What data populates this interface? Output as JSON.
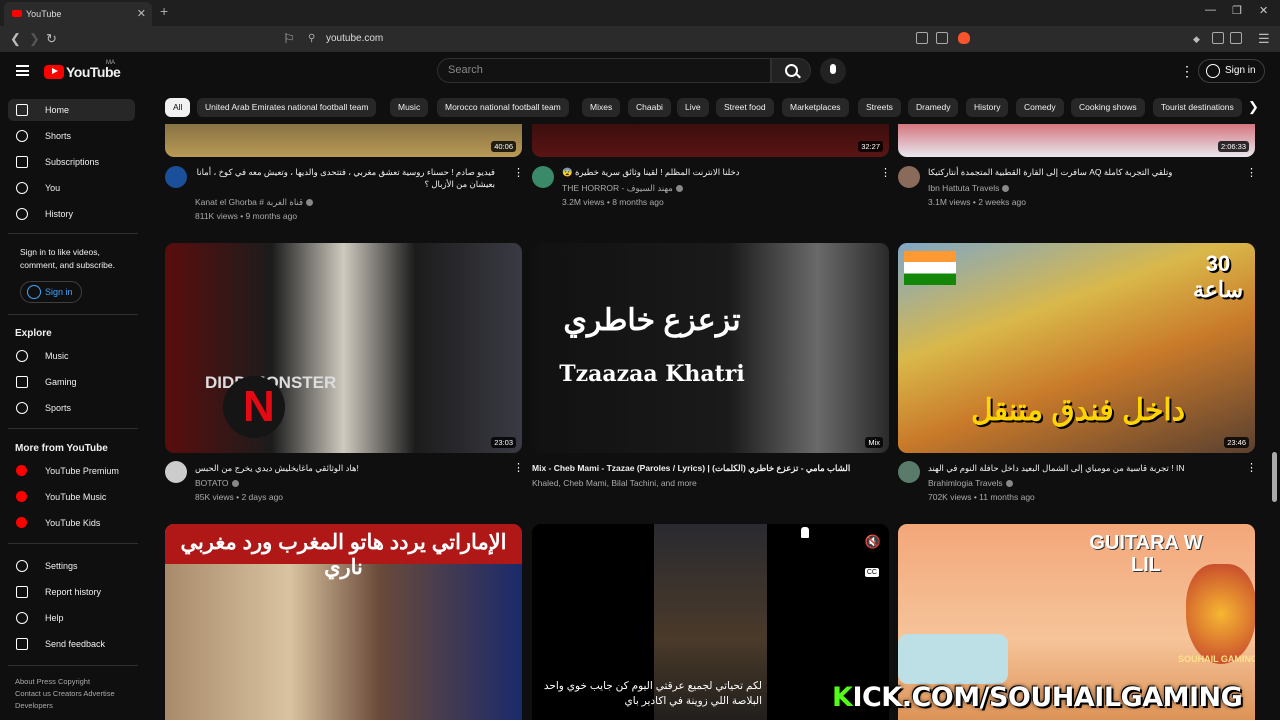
{
  "browser": {
    "tab_title": "YouTube",
    "url": "youtube.com"
  },
  "header": {
    "logo_text": "YouTube",
    "country_code": "MA",
    "search_placeholder": "Search",
    "signin_label": "Sign in"
  },
  "sidebar": {
    "nav": [
      {
        "label": "Home",
        "icon": "home-icon"
      },
      {
        "label": "Shorts",
        "icon": "shorts-icon"
      },
      {
        "label": "Subscriptions",
        "icon": "subscriptions-icon"
      },
      {
        "label": "You",
        "icon": "you-icon"
      },
      {
        "label": "History",
        "icon": "history-icon"
      }
    ],
    "signin_note": "Sign in to like videos, comment, and subscribe.",
    "signin_label": "Sign in",
    "explore_heading": "Explore",
    "explore": [
      {
        "label": "Music",
        "icon": "music-icon"
      },
      {
        "label": "Gaming",
        "icon": "gaming-icon"
      },
      {
        "label": "Sports",
        "icon": "sports-icon"
      }
    ],
    "more_heading": "More from YouTube",
    "more": [
      {
        "label": "YouTube Premium",
        "icon": "youtube-premium-icon"
      },
      {
        "label": "YouTube Music",
        "icon": "youtube-music-icon"
      },
      {
        "label": "YouTube Kids",
        "icon": "youtube-kids-icon"
      }
    ],
    "settings": [
      {
        "label": "Settings",
        "icon": "gear-icon"
      },
      {
        "label": "Report history",
        "icon": "flag-icon"
      },
      {
        "label": "Help",
        "icon": "help-icon"
      },
      {
        "label": "Send feedback",
        "icon": "feedback-icon"
      }
    ],
    "footer_line1": "About  Press  Copyright",
    "footer_line2": "Contact us  Creators  Advertise",
    "footer_line3": "Developers"
  },
  "chips": [
    "All",
    "United Arab Emirates national football team",
    "Music",
    "Morocco national football team",
    "Mixes",
    "Chaabi",
    "Live",
    "Street food",
    "Marketplaces",
    "Streets",
    "Dramedy",
    "History",
    "Comedy",
    "Cooking shows",
    "Tourist destinations"
  ],
  "videos": [
    {
      "title": "فيديو صادم ! حسناء روسية تعشق مغربي ، فتتحدى والديها ، وتعيش معه في كوخ ، أمانا بعيشان من الأزبال ؟",
      "channel": "Kanat el Ghorba # قناة الغربة",
      "meta": "811K views • 9 months ago",
      "duration": "40:06"
    },
    {
      "title": "😨 دخلنا الانترنت المظلم ! لقينا وثائق سرية خطيرة",
      "channel": "THE HORROR - مهند السيوف",
      "meta": "3.2M views • 8 months ago",
      "duration": "32:27"
    },
    {
      "title": "سافرت إلى القارة القطبية المتجمدة أنتاركتيكا AQ وتلقي التجربة كاملة",
      "channel": "Ibn Hattuta Travels",
      "meta": "3.1M views • 2 weeks ago",
      "duration": "2:06:33"
    },
    {
      "title": "هاد الوثائقي ماغايخليش ديدي يخرج من الحبس!",
      "channel": "BOTATO",
      "meta": "85K views • 2 days ago",
      "duration": "23:03",
      "thumb_text": "DIDD MONSTER"
    },
    {
      "title": "Mix - Cheb Mami - Tzazae (Paroles / Lyrics) | (الكلمات) الشاب مامي - تزعزع خاطري",
      "channel": "Khaled, Cheb Mami, Bilal Tachini, and more",
      "meta": "",
      "duration": "Mix",
      "thumb_text_ar": "تزعزع خاطري",
      "thumb_text": "Tzaazaa Khatri"
    },
    {
      "title": "تجربة قاسية من مومباي إلى الشمال البعيد داخل حافلة النوم في الهند ! IN",
      "channel": "Brahimlogia Travels",
      "meta": "702K views • 11 months ago",
      "duration": "23:46",
      "thumb_text_ar": "داخل فندق متنقل",
      "thumb_badge": "30 ساعة"
    },
    {
      "title": "",
      "channel": "",
      "meta": "",
      "duration": "",
      "thumb_text_ar": "الإماراتي يردد هاتو المغرب ورد مغربي ناري"
    },
    {
      "title": "",
      "channel": "",
      "meta": "",
      "duration": "",
      "caption": "لكم تحياتي لجميع عرقتي اليوم كن جايب خوي واحد البلاصة اللي زوينة في اكادير باي"
    },
    {
      "title": "",
      "channel": "",
      "meta": "",
      "duration": "",
      "thumb_text": "GUITARA W LIL",
      "thumb_text2": "SOUHAIL GAMING"
    }
  ],
  "overlay_watermark": "KICK.COM/SOUHAILGAMING",
  "colors": {
    "accent": "#ff0000",
    "link": "#3ea6ff",
    "kick": "#53fc18"
  }
}
